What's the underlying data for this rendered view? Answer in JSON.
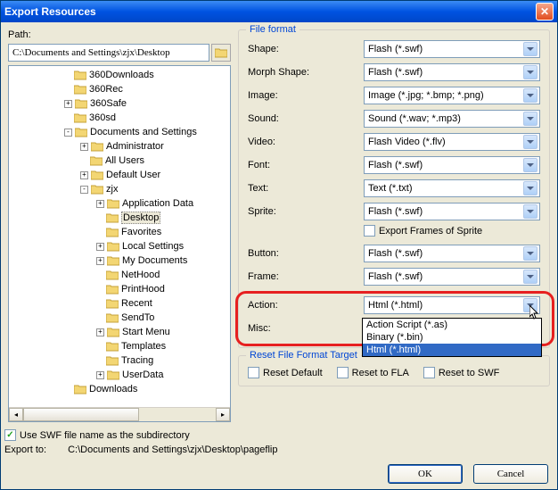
{
  "title": "Export Resources",
  "path": {
    "label": "Path:",
    "value": "C:\\Documents and Settings\\zjx\\Desktop"
  },
  "tree": {
    "nodes": [
      {
        "level": 0,
        "exp": "",
        "label": "360Downloads"
      },
      {
        "level": 0,
        "exp": "",
        "label": "360Rec"
      },
      {
        "level": 0,
        "exp": "+",
        "label": "360Safe"
      },
      {
        "level": 0,
        "exp": "",
        "label": "360sd"
      },
      {
        "level": 0,
        "exp": "-",
        "label": "Documents and Settings"
      },
      {
        "level": 1,
        "exp": "+",
        "label": "Administrator"
      },
      {
        "level": 1,
        "exp": "",
        "label": "All Users"
      },
      {
        "level": 1,
        "exp": "+",
        "label": "Default User"
      },
      {
        "level": 1,
        "exp": "-",
        "label": "zjx"
      },
      {
        "level": 2,
        "exp": "+",
        "label": "Application Data"
      },
      {
        "level": 2,
        "exp": "",
        "label": "Desktop",
        "selected": true
      },
      {
        "level": 2,
        "exp": "",
        "label": "Favorites"
      },
      {
        "level": 2,
        "exp": "+",
        "label": "Local Settings"
      },
      {
        "level": 2,
        "exp": "+",
        "label": "My Documents"
      },
      {
        "level": 2,
        "exp": "",
        "label": "NetHood"
      },
      {
        "level": 2,
        "exp": "",
        "label": "PrintHood"
      },
      {
        "level": 2,
        "exp": "",
        "label": "Recent"
      },
      {
        "level": 2,
        "exp": "",
        "label": "SendTo"
      },
      {
        "level": 2,
        "exp": "+",
        "label": "Start Menu"
      },
      {
        "level": 2,
        "exp": "",
        "label": "Templates"
      },
      {
        "level": 2,
        "exp": "",
        "label": "Tracing"
      },
      {
        "level": 2,
        "exp": "+",
        "label": "UserData"
      },
      {
        "level": 0,
        "exp": "",
        "label": "Downloads"
      }
    ]
  },
  "file_format": {
    "legend": "File format",
    "rows": [
      {
        "label": "Shape:",
        "value": "Flash (*.swf)"
      },
      {
        "label": "Morph Shape:",
        "value": "Flash (*.swf)"
      },
      {
        "label": "Image:",
        "value": "Image (*.jpg; *.bmp; *.png)"
      },
      {
        "label": "Sound:",
        "value": "Sound (*.wav; *.mp3)"
      },
      {
        "label": "Video:",
        "value": "Flash Video (*.flv)"
      },
      {
        "label": "Font:",
        "value": "Flash (*.swf)"
      },
      {
        "label": "Text:",
        "value": "Text (*.txt)"
      },
      {
        "label": "Sprite:",
        "value": "Flash (*.swf)"
      },
      {
        "label": "Button:",
        "value": "Flash (*.swf)"
      },
      {
        "label": "Frame:",
        "value": "Flash (*.swf)"
      },
      {
        "label": "Action:",
        "value": "Html (*.html)",
        "open": true
      },
      {
        "label": "Misc:",
        "value": ""
      }
    ],
    "sprite_checkbox": "Export Frames of Sprite",
    "action_options": [
      "Action Script (*.as)",
      "Binary (*.bin)",
      "Html (*.html)"
    ]
  },
  "reset": {
    "legend": "Reset File Format Target",
    "opts": [
      "Reset Default",
      "Reset to FLA",
      "Reset to SWF"
    ]
  },
  "footer": {
    "subdir": "Use SWF file name as the subdirectory",
    "export_label": "Export to:",
    "export_value": "C:\\Documents and Settings\\zjx\\Desktop\\pageflip",
    "ok": "OK",
    "cancel": "Cancel"
  }
}
